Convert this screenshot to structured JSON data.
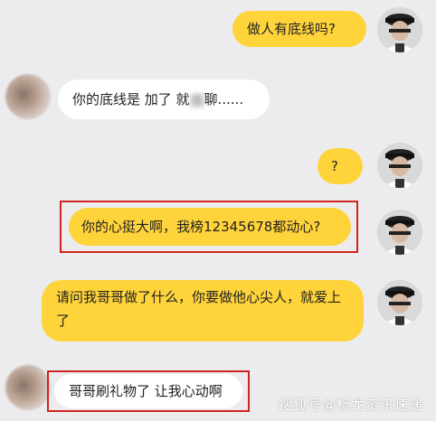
{
  "messages": [
    {
      "side": "out",
      "text": "做人有底线吗?"
    },
    {
      "side": "in",
      "text_before": "你的底线是 加了 就",
      "text_after": "聊......"
    },
    {
      "side": "out",
      "text": "?"
    },
    {
      "side": "out",
      "text": "你的心挺大啊，我榜12345678都动心?"
    },
    {
      "side": "out",
      "text": "请问我哥哥做了什么，你要做他心尖人，就爱上了"
    },
    {
      "side": "in",
      "text": "哥哥刷礼物了 让我心动啊"
    }
  ],
  "watermark": "搜狐号@标龙资讯速递",
  "colors": {
    "outgoing_bubble": "#ffd33a",
    "incoming_bubble": "#ffffff",
    "highlight_box": "#d2231e",
    "background": "#ececef"
  },
  "icons": {
    "outgoing_avatar": "man-in-cap-avatar",
    "incoming_avatar": "blurred-avatar"
  }
}
